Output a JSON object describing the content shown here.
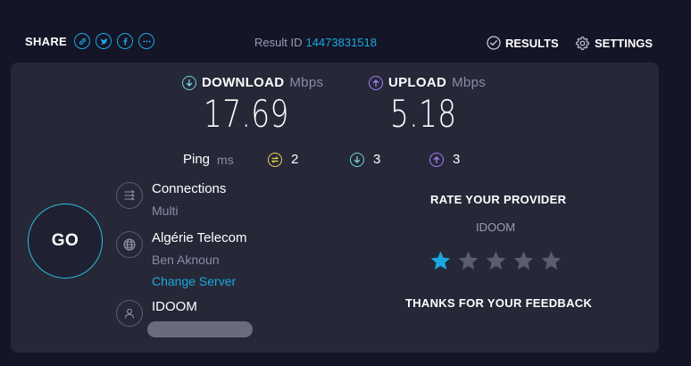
{
  "share": {
    "label": "SHARE",
    "icons": [
      "link-icon",
      "twitter-icon",
      "facebook-icon",
      "more-icon"
    ]
  },
  "result": {
    "label": "Result ID",
    "id": "14473831518"
  },
  "nav": {
    "results": "RESULTS",
    "settings": "SETTINGS"
  },
  "download": {
    "label": "DOWNLOAD",
    "unit": "Mbps",
    "value": "17.69"
  },
  "upload": {
    "label": "UPLOAD",
    "unit": "Mbps",
    "value": "5.18"
  },
  "ping": {
    "label": "Ping",
    "unit": "ms",
    "idle": "2",
    "download": "3",
    "upload": "3"
  },
  "go": {
    "label": "GO"
  },
  "connections": {
    "title": "Connections",
    "value": "Multi"
  },
  "server": {
    "name": "Algérie Telecom",
    "location": "Ben Aknoun",
    "change": "Change Server"
  },
  "provider": {
    "name": "IDOOM"
  },
  "rating": {
    "title": "RATE YOUR PROVIDER",
    "provider": "IDOOM",
    "stars": 1,
    "max": 5,
    "thanks": "THANKS FOR YOUR FEEDBACK"
  },
  "colors": {
    "accent": "#1ba8e0",
    "download": "#6fd3d3",
    "upload": "#a77cf3",
    "ping": "#e8d54a",
    "star_active": "#1ba8e0",
    "star_inactive": "#5a5c70"
  }
}
